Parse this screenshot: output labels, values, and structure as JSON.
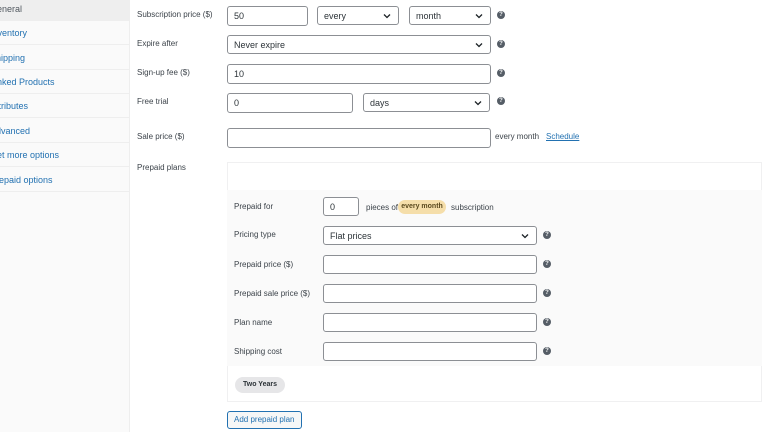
{
  "sidebar": {
    "items": [
      {
        "label": "General"
      },
      {
        "label": "Inventory"
      },
      {
        "label": "Shipping"
      },
      {
        "label": "Linked Products"
      },
      {
        "label": "Attributes"
      },
      {
        "label": "Advanced"
      },
      {
        "label": "Get more options"
      },
      {
        "label": "Prepaid options"
      }
    ]
  },
  "form": {
    "subscription_price": {
      "label": "Subscription price ($)",
      "value": "50",
      "interval": "every",
      "period": "month"
    },
    "expire_after": {
      "label": "Expire after",
      "value": "Never expire"
    },
    "signup_fee": {
      "label": "Sign-up fee ($)",
      "value": "10"
    },
    "free_trial": {
      "label": "Free trial",
      "value": "0",
      "period": "days"
    },
    "sale_price": {
      "label": "Sale price ($)",
      "value": "",
      "suffix": "every month",
      "schedule_link": "Schedule"
    }
  },
  "prepaid": {
    "section_label": "Prepaid plans",
    "prepaid_for": {
      "label": "Prepaid for",
      "value": "0",
      "pieces_of": "pieces of",
      "badge": "every month",
      "suffix": "subscription"
    },
    "pricing_type": {
      "label": "Pricing type",
      "value": "Flat prices"
    },
    "prepaid_price": {
      "label": "Prepaid price ($)",
      "value": ""
    },
    "prepaid_sale_price": {
      "label": "Prepaid sale price ($)",
      "value": ""
    },
    "plan_name": {
      "label": "Plan name",
      "value": ""
    },
    "shipping_cost": {
      "label": "Shipping cost",
      "value": ""
    },
    "plan_tag": "Two Years",
    "add_button": "Add prepaid plan"
  },
  "icons": {
    "help": "?",
    "chevron": "chevron-down-icon"
  },
  "colors": {
    "link": "#2271b1",
    "badge": "#f5deaa",
    "border": "#8c8f94"
  }
}
